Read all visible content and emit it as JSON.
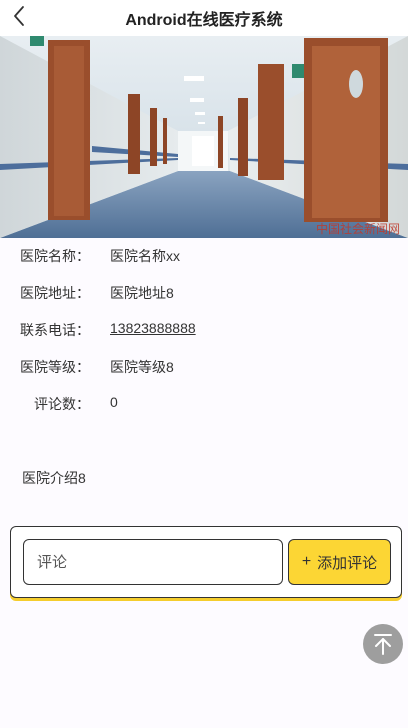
{
  "header": {
    "title": "Android在线医疗系统",
    "back_icon": "chevron-left-icon"
  },
  "hero": {
    "image": "hospital-corridor-photo",
    "watermark": "中国社会新闻网"
  },
  "hospital": {
    "fields": [
      {
        "label": "医院名称：",
        "value": "医院名称xx"
      },
      {
        "label": "医院地址：",
        "value": "医院地址8"
      },
      {
        "label": "联系电话：",
        "value": "13823888888"
      },
      {
        "label": "医院等级：",
        "value": "医院等级8"
      },
      {
        "label": "评论数：",
        "value": "0"
      }
    ],
    "intro": "医院介绍8"
  },
  "comment": {
    "placeholder": "评论",
    "button_label": "添加评论",
    "button_icon": "plus-icon"
  },
  "scroll_top": {
    "icon": "arrow-up-to-top-icon"
  },
  "colors": {
    "accent": "#fcd634",
    "background": "#fdfbff",
    "scroll_button": "#9e9e9e"
  }
}
